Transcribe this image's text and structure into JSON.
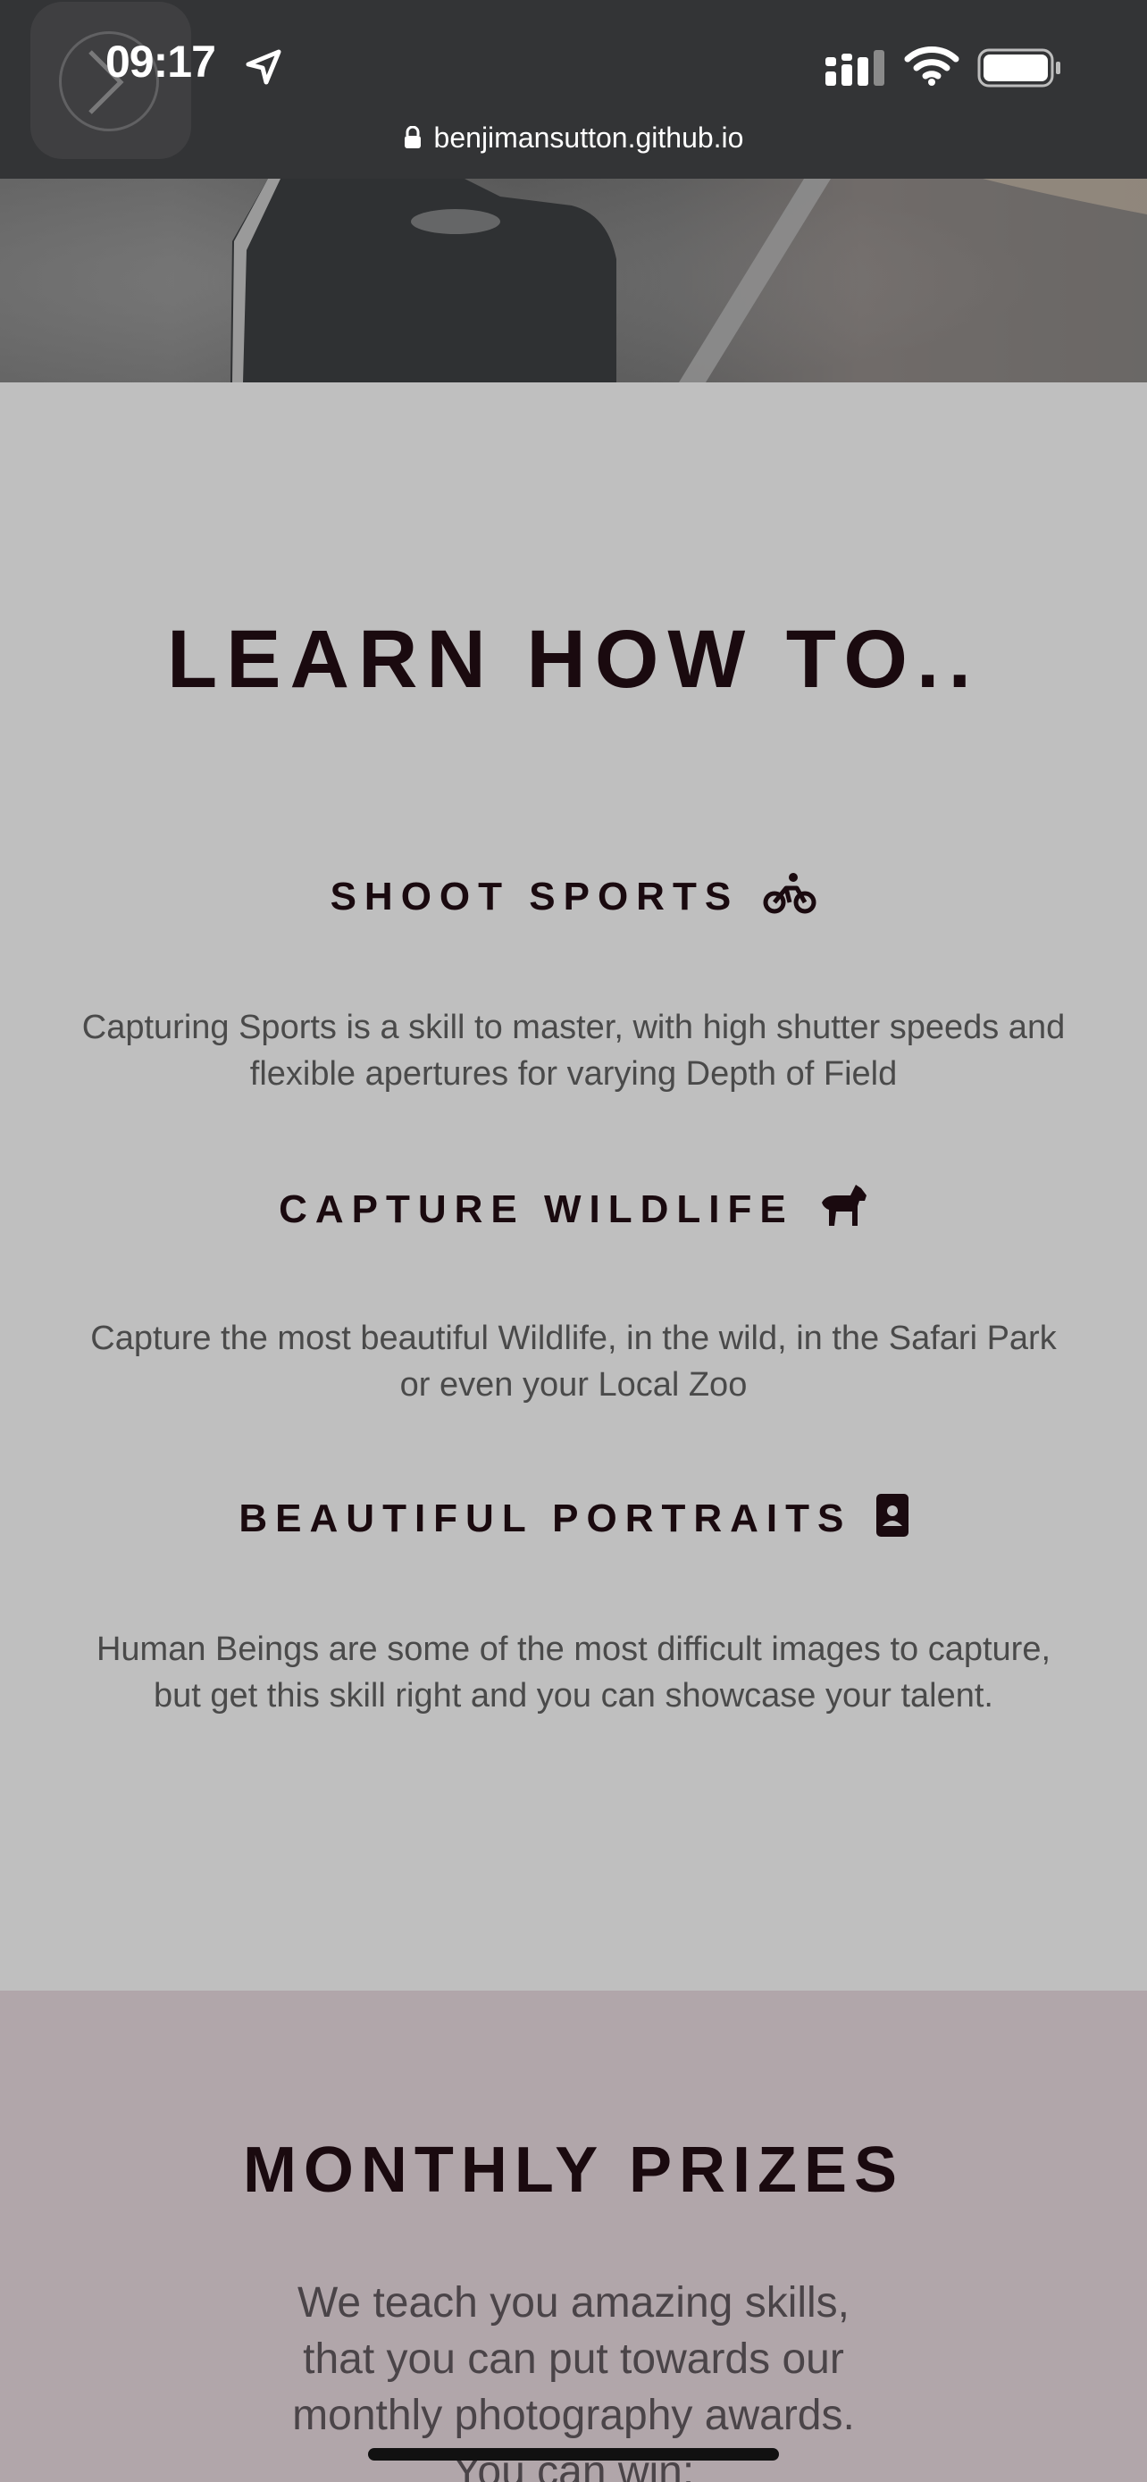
{
  "status_bar": {
    "time": "09:17",
    "icons": [
      "location-arrow-icon",
      "cellular-signal-icon",
      "wifi-icon",
      "battery-icon"
    ]
  },
  "browser": {
    "url": "benjimansutton.github.io",
    "lock_icon": "lock-icon"
  },
  "learn": {
    "title": "LEARN HOW TO..",
    "skills": [
      {
        "heading": "SHOOT SPORTS",
        "icon": "bicycle-rider-icon",
        "text_line1": "Capturing Sports is a skill to master, with high shutter speeds and",
        "text_line2": "flexible apertures for varying Depth of Field"
      },
      {
        "heading": "CAPTURE WILDLIFE",
        "icon": "horse-icon",
        "text_line1": "Capture the most beautiful Wildlife, in the wild, in the Safari Park",
        "text_line2": "or even your Local Zoo"
      },
      {
        "heading": "BEAUTIFUL PORTRAITS",
        "icon": "portrait-icon",
        "text_line1": "Human Beings are some of the most difficult images to capture,",
        "text_line2": "but get this skill right and you can showcase your talent."
      }
    ]
  },
  "prizes": {
    "title": "MONTHLY PRIZES",
    "lines": [
      "We teach you amazing skills,",
      "that you can put towards our",
      "monthly photography awards.",
      "You can win:"
    ]
  },
  "colors": {
    "status_bar_bg": "#333436",
    "learn_bg": "#bfbfbf",
    "prizes_bg": "#b1a6aa",
    "heading_text": "#1a0a0f",
    "body_text": "#4a4a4a"
  }
}
